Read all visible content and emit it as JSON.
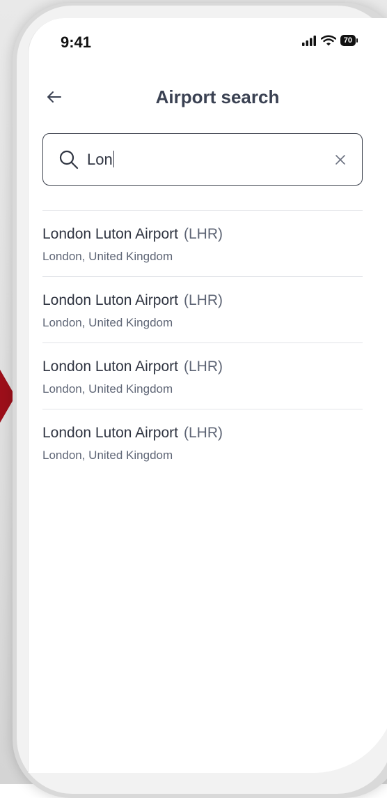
{
  "status_bar": {
    "time": "9:41",
    "battery": "70"
  },
  "header": {
    "title": "Airport search",
    "back_icon": "arrow-left-icon"
  },
  "search": {
    "value": "Lon",
    "icon": "search-icon",
    "clear_icon": "close-icon"
  },
  "results": [
    {
      "name": "London Luton Airport",
      "code": "(LHR)",
      "location": "London, United Kingdom"
    },
    {
      "name": "London Luton Airport",
      "code": "(LHR)",
      "location": "London, United Kingdom"
    },
    {
      "name": "London Luton Airport",
      "code": "(LHR)",
      "location": "London, United Kingdom"
    },
    {
      "name": "London Luton Airport",
      "code": "(LHR)",
      "location": "London, United Kingdom"
    }
  ],
  "colors": {
    "accent": "#9d0f1a",
    "text": "#2f3441",
    "muted": "#5f6676"
  }
}
